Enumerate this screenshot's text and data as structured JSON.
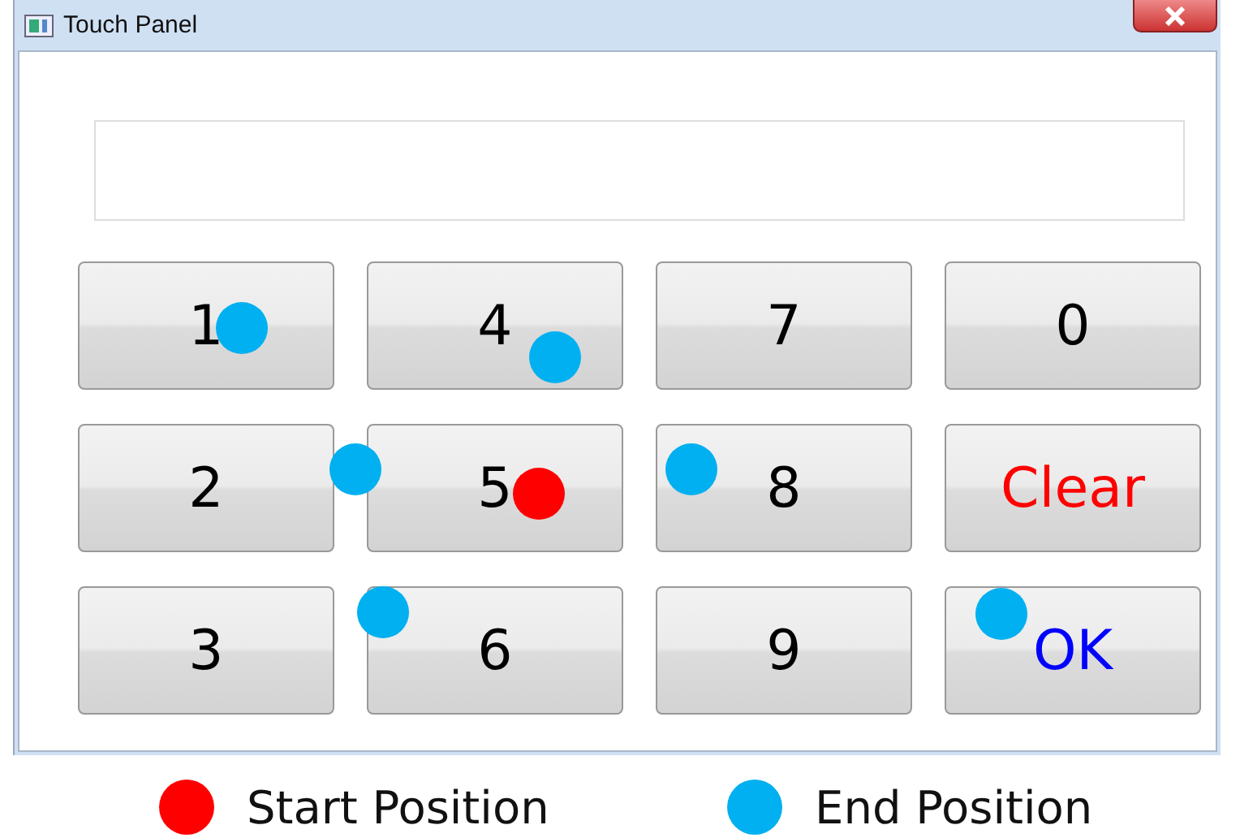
{
  "window": {
    "title": "Touch Panel"
  },
  "keys": [
    {
      "label": "1",
      "color": "#000000"
    },
    {
      "label": "4",
      "color": "#000000"
    },
    {
      "label": "7",
      "color": "#000000"
    },
    {
      "label": "0",
      "color": "#000000"
    },
    {
      "label": "2",
      "color": "#000000"
    },
    {
      "label": "5",
      "color": "#000000"
    },
    {
      "label": "8",
      "color": "#000000"
    },
    {
      "label": "Clear",
      "color": "#ff0000"
    },
    {
      "label": "3",
      "color": "#000000"
    },
    {
      "label": "6",
      "color": "#000000"
    },
    {
      "label": "9",
      "color": "#000000"
    },
    {
      "label": "OK",
      "color": "#0000ff"
    }
  ],
  "touch_points": [
    {
      "color": "#00b0f0"
    },
    {
      "color": "#00b0f0"
    },
    {
      "color": "#00b0f0"
    },
    {
      "color": "#ff0000"
    },
    {
      "color": "#00b0f0"
    },
    {
      "color": "#00b0f0"
    },
    {
      "color": "#00b0f0"
    }
  ],
  "legend": [
    {
      "label": "Start Position",
      "color": "#ff0000"
    },
    {
      "label": "End Position",
      "color": "#00b0f0"
    }
  ]
}
